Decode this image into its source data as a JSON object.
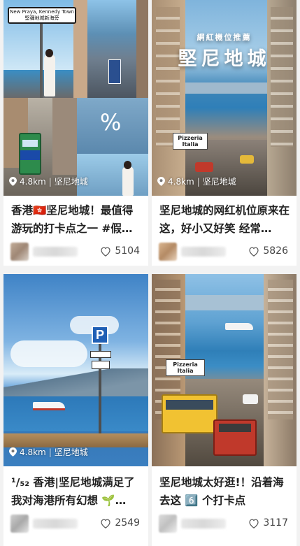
{
  "cards": [
    {
      "title": "香港🇭🇰坚尼地城！最值得游玩的打卡点之一 #假…",
      "location": "4.8km",
      "place": "坚尼地城",
      "likes": "5104",
      "street_sign_line1": "New Praya, Kennedy Town",
      "street_sign_line2": "堅彌地城新海旁",
      "percent_glyph": "%"
    },
    {
      "title": "坚尼地城的网红机位原来在这，好小又好笑 经常…",
      "location": "4.8km",
      "place": "坚尼地城",
      "likes": "5826",
      "overlay_small": "網紅機位推薦",
      "overlay_big": "堅尼地城",
      "shop_sign": "Pizzeria Italia"
    },
    {
      "title": "¹/₅₂ 香港|坚尼地城满足了我对海港所有幻想 🌱…",
      "location": "4.8km",
      "place": "坚尼地城",
      "likes": "2549",
      "parking_sign": "P"
    },
    {
      "title": "坚尼地城太好逛!！沿着海去这 6️⃣ 个打卡点",
      "likes": "3117",
      "shop_sign": "Pizzeria Italia"
    }
  ],
  "colors": {
    "sky": "#9ed0f0",
    "sea": "#2f7fb8",
    "tram_green": "#2f8a4a",
    "bus_red": "#c0392b",
    "parking_blue": "#1f5fb5"
  },
  "icons": {
    "location": "pin-icon",
    "likes": "heart-icon"
  }
}
